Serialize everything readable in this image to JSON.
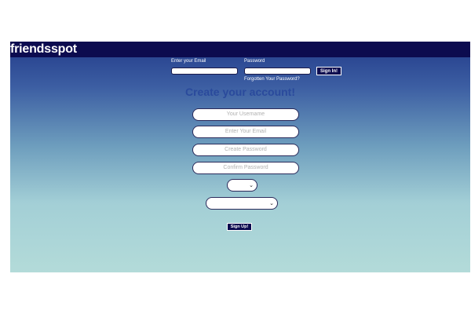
{
  "brand": {
    "logo": "friendsspot"
  },
  "login": {
    "email_label": "Enter your Email",
    "password_label": "Password",
    "email_value": "",
    "password_value": "",
    "signin_label": "Sign In!",
    "forgot_label": "Forgotten Your Password?"
  },
  "signup": {
    "heading": "Create your account!",
    "username_placeholder": "Your Username",
    "email_placeholder": "Enter Your Email",
    "password_placeholder": "Create Password",
    "confirm_placeholder": "Confirm Password",
    "select1_value": "",
    "select2_value": "",
    "signup_label": "Sign Up!"
  },
  "icons": {
    "dropdown": "chevron-down-icon"
  },
  "colors": {
    "topbar": "#0c0b4f",
    "heading": "#2a4a9c"
  }
}
